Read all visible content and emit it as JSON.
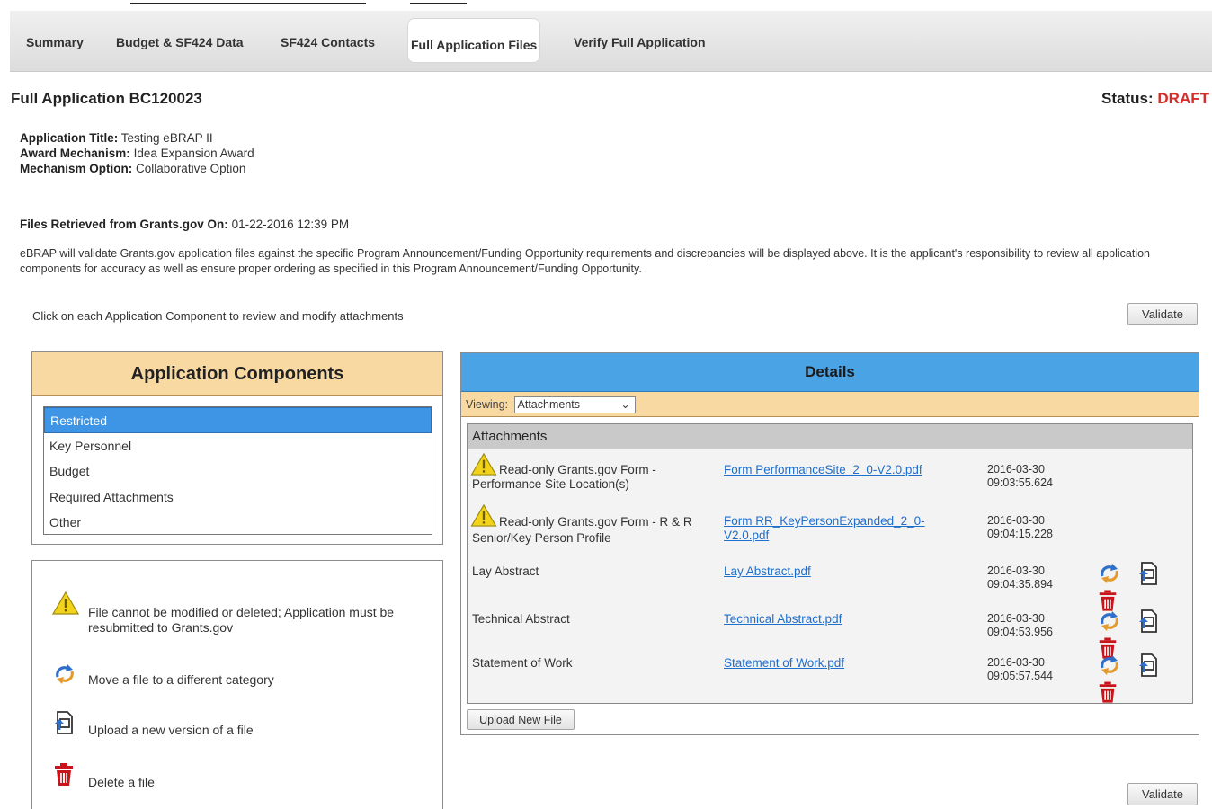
{
  "tabs": [
    {
      "label": "Summary",
      "active": false
    },
    {
      "label": "Budget & SF424 Data",
      "active": false
    },
    {
      "label": "SF424 Contacts",
      "active": false
    },
    {
      "label": "Full Application Files",
      "active": true
    },
    {
      "label": "Verify Full Application",
      "active": false
    }
  ],
  "header": {
    "title": "Full Application BC120023",
    "status_label": "Status:",
    "status_value": "DRAFT"
  },
  "meta": {
    "app_title_label": "Application Title:",
    "app_title_value": "Testing eBRAP II",
    "award_label": "Award Mechanism:",
    "award_value": "Idea Expansion Award",
    "option_label": "Mechanism Option:",
    "option_value": "Collaborative Option"
  },
  "retrieved": {
    "label": "Files Retrieved from Grants.gov On:",
    "value": "01-22-2016 12:39 PM"
  },
  "notice": "eBRAP will validate Grants.gov application files against the specific Program Announcement/Funding Opportunity requirements and discrepancies will be displayed above. It is the applicant's responsibility to review all application components for accuracy as well as ensure proper ordering as specified in this Program Announcement/Funding Opportunity.",
  "instructions": "Click on each Application Component to review and modify attachments",
  "buttons": {
    "validate": "Validate",
    "upload_new": "Upload New File"
  },
  "components": {
    "title": "Application Components",
    "items": [
      {
        "label": "Restricted",
        "selected": true
      },
      {
        "label": "Key Personnel",
        "selected": false
      },
      {
        "label": "Budget",
        "selected": false
      },
      {
        "label": "Required Attachments",
        "selected": false
      },
      {
        "label": "Other",
        "selected": false
      }
    ]
  },
  "legend": {
    "items": [
      {
        "icon": "warning-icon",
        "text": "File cannot be modified or deleted; Application must be resubmitted to Grants.gov"
      },
      {
        "icon": "move-icon",
        "text": "Move a file to a different category"
      },
      {
        "icon": "upload-icon",
        "text": "Upload a new version of a file"
      },
      {
        "icon": "trash-icon",
        "text": "Delete a file"
      }
    ]
  },
  "details": {
    "title": "Details",
    "viewing_label": "Viewing:",
    "viewing_value": "Attachments",
    "attachments_header": "Attachments",
    "rows": [
      {
        "warning": true,
        "name": "Read-only Grants.gov Form - Performance Site Location(s)",
        "file": "Form PerformanceSite_2_0-V2.0.pdf",
        "date": "2016-03-30",
        "time": "09:03:55.624"
      },
      {
        "warning": true,
        "name": "Read-only Grants.gov Form - R & R Senior/Key Person Profile",
        "file": "Form RR_KeyPersonExpanded_2_0-V2.0.pdf",
        "date": "2016-03-30",
        "time": "09:04:15.228"
      },
      {
        "warning": false,
        "name": "Lay Abstract",
        "file": "Lay Abstract.pdf",
        "date": "2016-03-30",
        "time": "09:04:35.894"
      },
      {
        "warning": false,
        "name": "Technical Abstract",
        "file": "Technical Abstract.pdf",
        "date": "2016-03-30",
        "time": "09:04:53.956"
      },
      {
        "warning": false,
        "name": "Statement of Work",
        "file": "Statement of Work.pdf",
        "date": "2016-03-30",
        "time": "09:05:57.544"
      }
    ]
  },
  "colors": {
    "accent_blue": "#4aa3e4",
    "header_tan": "#f9d9a2",
    "status_red": "#d62b2b",
    "link_blue": "#1f6fcc",
    "trash_red": "#c8141a"
  }
}
